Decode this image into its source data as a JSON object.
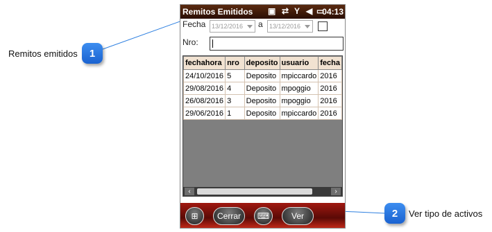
{
  "callouts": [
    {
      "number": "1",
      "label": "Remitos emitidos"
    },
    {
      "number": "2",
      "label": "Ver tipo de activos"
    }
  ],
  "status_bar": {
    "title": "Remitos Emitidos",
    "time": "04:13"
  },
  "filters": {
    "fecha_label": "Fecha",
    "date_from": "13/12/2016",
    "a_label": "a",
    "date_to": "13/12/2016",
    "nro_label": "Nro:",
    "nro_value": ""
  },
  "table": {
    "columns": [
      "fechahora",
      "nro",
      "deposito",
      "usuario",
      "fecha"
    ],
    "rows": [
      [
        "24/10/2016",
        "5",
        "Deposito",
        "mpiccardo",
        "2016"
      ],
      [
        "29/08/2016",
        "4",
        "Deposito",
        "mpoggio",
        "2016"
      ],
      [
        "26/08/2016",
        "3",
        "Deposito",
        "mpoggio",
        "2016"
      ],
      [
        "29/06/2016",
        "1",
        "Deposito",
        "mpiccardo",
        "2016"
      ]
    ]
  },
  "bottom_bar": {
    "close_label": "Cerrar",
    "view_label": "Ver"
  }
}
